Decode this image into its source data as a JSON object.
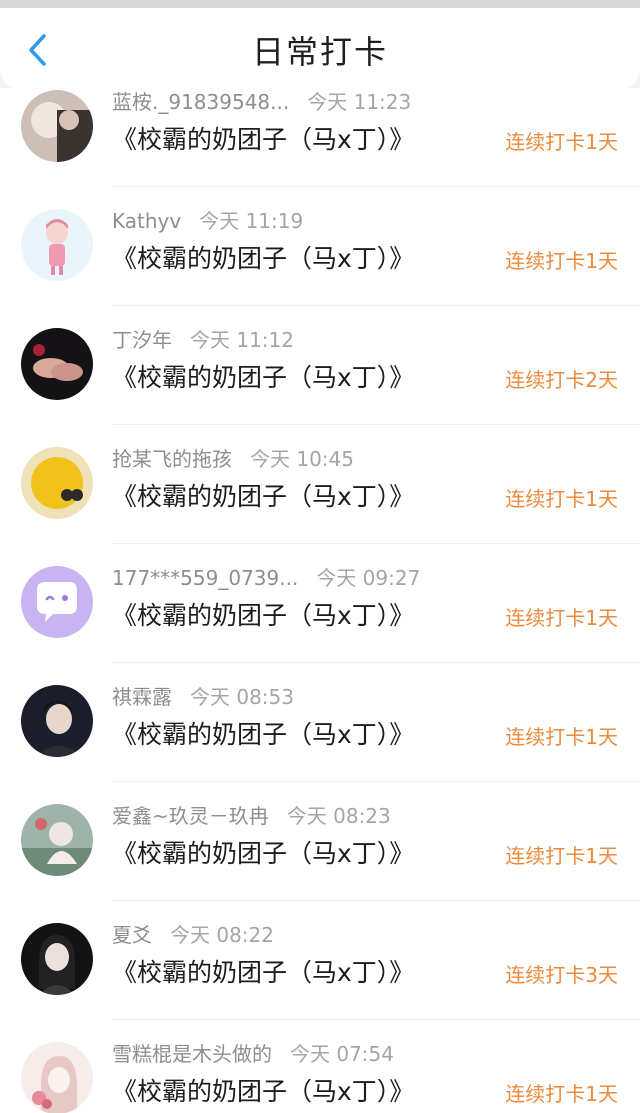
{
  "header": {
    "title": "日常打卡",
    "back_icon": "chevron-left-icon"
  },
  "colors": {
    "accent_blue": "#2e9bf0",
    "streak_orange": "#ee8a3b",
    "meta_gray": "#8e8e8e"
  },
  "entries": [
    {
      "user": "蓝桉._91839548...",
      "time": "今天 11:23",
      "book": "《校霸的奶团子（马x丁）》",
      "streak": "连续打卡1天"
    },
    {
      "user": "Kathyv",
      "time": "今天 11:19",
      "book": "《校霸的奶团子（马x丁）》",
      "streak": "连续打卡1天"
    },
    {
      "user": "丁汐年",
      "time": "今天 11:12",
      "book": "《校霸的奶团子（马x丁）》",
      "streak": "连续打卡2天"
    },
    {
      "user": "抢某飞的拖孩",
      "time": "今天 10:45",
      "book": "《校霸的奶团子（马x丁）》",
      "streak": "连续打卡1天"
    },
    {
      "user": "177***559_0739...",
      "time": "今天 09:27",
      "book": "《校霸的奶团子（马x丁）》",
      "streak": "连续打卡1天"
    },
    {
      "user": "祺霖露",
      "time": "今天 08:53",
      "book": "《校霸的奶团子（马x丁）》",
      "streak": "连续打卡1天"
    },
    {
      "user": "爱鑫~玖灵－玖冉",
      "time": "今天 08:23",
      "book": "《校霸的奶团子（马x丁）》",
      "streak": "连续打卡1天"
    },
    {
      "user": "夏爻",
      "time": "今天 08:22",
      "book": "《校霸的奶团子（马x丁）》",
      "streak": "连续打卡3天"
    },
    {
      "user": "雪糕棍是木头做的",
      "time": "今天 07:54",
      "book": "《校霸的奶团子（马x丁）》",
      "streak": "连续打卡1天"
    }
  ]
}
